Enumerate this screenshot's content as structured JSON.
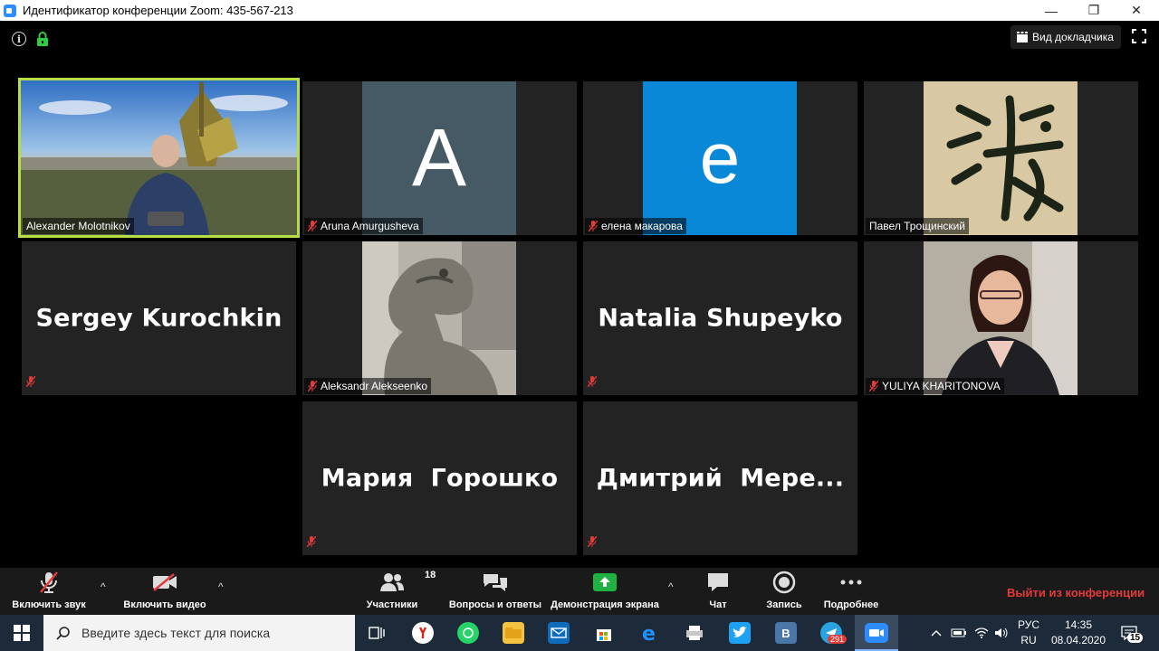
{
  "window": {
    "title": "Идентификатор конференции Zoom: 435-567-213",
    "min_glyph": "—",
    "max_glyph": "❐",
    "close_glyph": "✕"
  },
  "top_bar": {
    "info_glyph": "i",
    "speaker_view_label": "Вид докладчика"
  },
  "tiles": [
    {
      "name": "Alexander Molotnikov",
      "kind": "video",
      "active": true,
      "muted": false
    },
    {
      "name": "Aruna Amurgusheva",
      "kind": "avatar",
      "avatar_letter": "A",
      "avatar_color": "#455a64",
      "muted": true
    },
    {
      "name": "елена макарова",
      "kind": "avatar",
      "avatar_letter": "e",
      "avatar_color": "#0a88d8",
      "muted": true
    },
    {
      "name": "Павел Трощинский",
      "kind": "image",
      "muted": false
    },
    {
      "name": "Sergey Kurochkin",
      "kind": "name",
      "muted": true
    },
    {
      "name": "Aleksandr Alekseenko",
      "kind": "image",
      "muted": true
    },
    {
      "name": "Natalia Shupeyko",
      "kind": "name",
      "muted": true
    },
    {
      "name": "YULIYA KHARITONOVA",
      "kind": "image",
      "muted": true
    },
    {
      "name": "Мария  Горошко",
      "kind": "name",
      "muted": true
    },
    {
      "name": "Дмитрий  Мере...",
      "kind": "name",
      "muted": true
    }
  ],
  "toolbar": {
    "unmute_label": "Включить звук",
    "start_video_label": "Включить видео",
    "participants_label": "Участники",
    "participants_count": "18",
    "qa_label": "Вопросы и ответы",
    "share_label": "Демонстрация экрана",
    "chat_label": "Чат",
    "record_label": "Запись",
    "more_label": "Подробнее",
    "leave_label": "Выйти из конференции",
    "caret_glyph": "^"
  },
  "taskbar": {
    "search_placeholder": "Введите здесь текст для поиска",
    "telegram_badge": "291",
    "vk_letter": "B",
    "lang_top": "РУС",
    "lang_bottom": "RU",
    "time": "14:35",
    "date": "08.04.2020",
    "notifications_count": "15"
  },
  "colors": {
    "active_speaker_border": "#b7df45",
    "leave_red": "#e53a3a",
    "share_green": "#1fb141",
    "tile_bg": "#232323"
  }
}
